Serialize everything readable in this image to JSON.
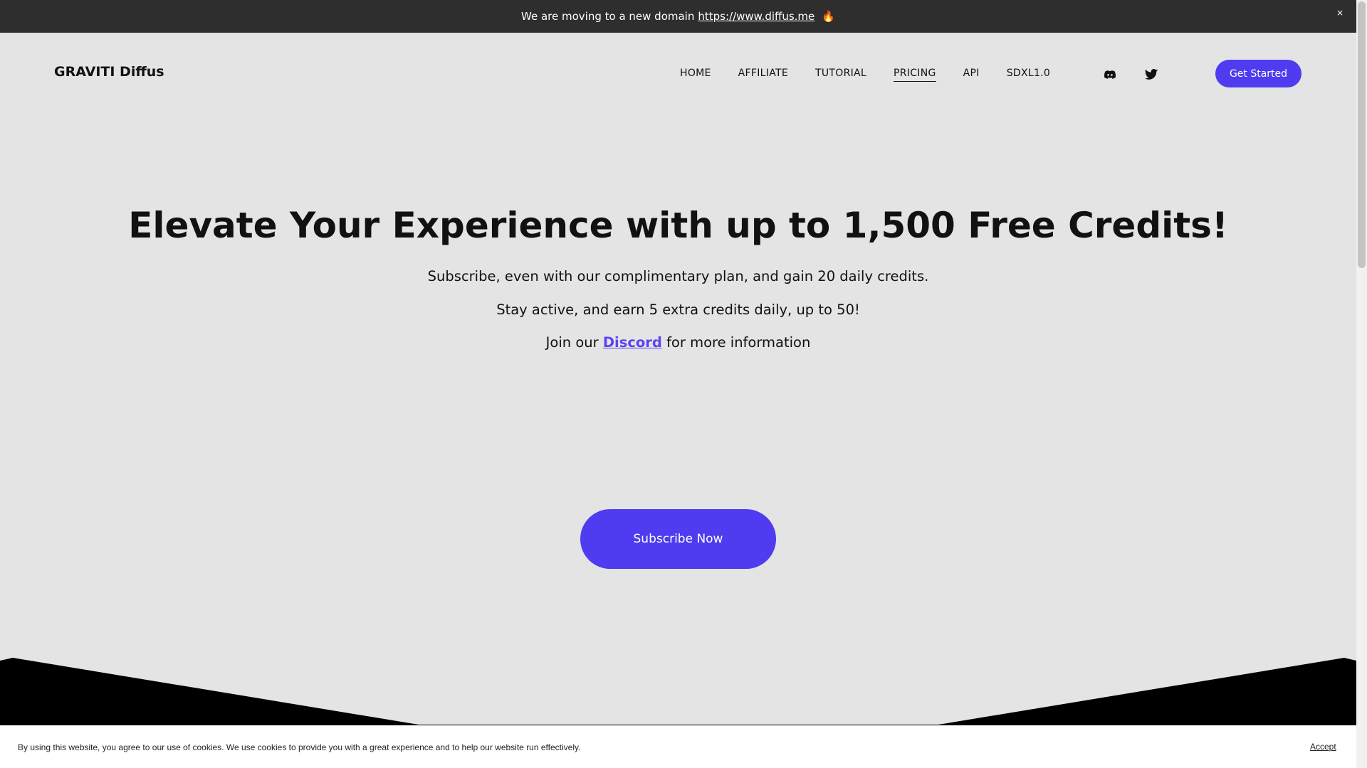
{
  "banner": {
    "text": "We are moving to a new domain",
    "link": "https://www.diffus.me",
    "emoji": "🔥",
    "close": "×"
  },
  "nav": {
    "logo": "GRAVITI Diffus",
    "items": [
      {
        "label": "HOME"
      },
      {
        "label": "AFFILIATE"
      },
      {
        "label": "TUTORIAL"
      },
      {
        "label": "PRICING",
        "active": true
      },
      {
        "label": "API"
      },
      {
        "label": "SDXL1.0"
      }
    ],
    "social_icons": [
      "discord-icon",
      "twitter-icon"
    ],
    "cta": "Get Started"
  },
  "hero": {
    "title": "Elevate Your Experience with up to 1,500 Free Credits!",
    "line1": "Subscribe, even with our complimentary plan, and gain 20 daily credits.",
    "line2": "Stay active, and earn 5 extra credits daily, up to 50!",
    "line3_prefix": "Join our",
    "line3_link": "Discord",
    "line3_suffix": "for more information",
    "button": "Subscribe Now"
  },
  "cookie": {
    "message": "By using this website, you agree to our use of cookies. We use cookies to provide you with a great experience and to help our website run effectively.",
    "accept": "Accept"
  },
  "colors": {
    "accent": "#4f3bf0",
    "banner_bg": "#2e2e2e",
    "page_bg": "#e4e4e4",
    "dark_section": "#000000"
  }
}
